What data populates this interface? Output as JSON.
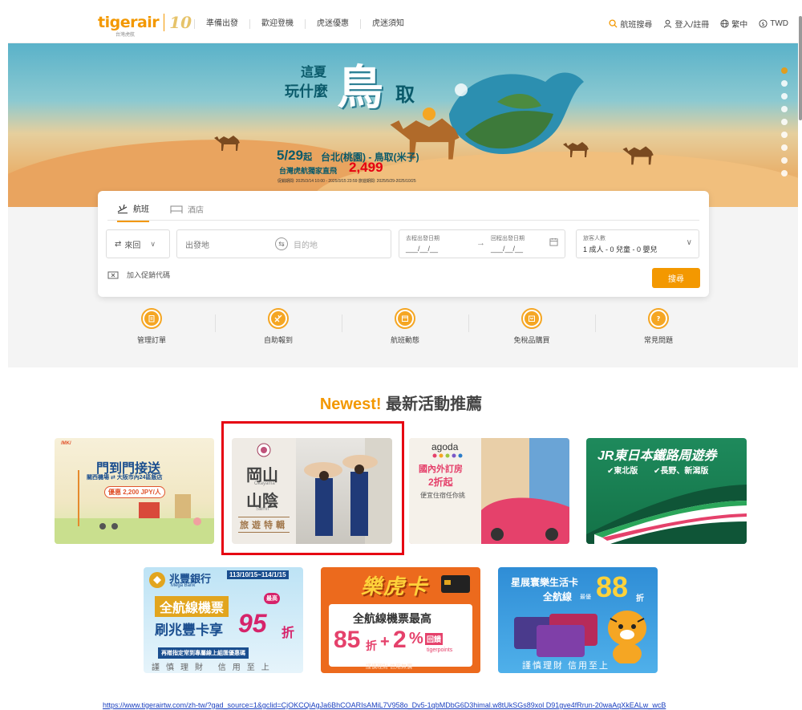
{
  "header": {
    "logo_text": "tigerair",
    "logo_sub": "台灣虎航",
    "logo_anniv": "10",
    "nav": [
      "準備出發",
      "歡迎登機",
      "虎迷優惠",
      "虎迷須知"
    ],
    "flight_search": "航班搜尋",
    "login": "登入/註冊",
    "language": "繁中",
    "currency": "TWD"
  },
  "hero": {
    "line1": "這夏",
    "line2": "玩什麼",
    "big": "鳥",
    "big2": "取",
    "date": "5/29",
    "date_small": "起",
    "route": "台北(桃園) - 鳥取(米子)",
    "price_label": "台灣虎航獨家直飛",
    "price": "2,499",
    "fine": "促銷期間: 2025/3/14 10:00 - 2025/3/15 23:59   旅遊期間: 2025/5/29-2025/10/25",
    "slide_count": 9,
    "active_slide": 0
  },
  "search": {
    "tab_flight": "航班",
    "tab_hotel": "酒店",
    "trip_type": "來回",
    "from_placeholder": "出發地",
    "to_placeholder": "目的地",
    "depart_label": "去程出發日期",
    "return_label": "回程出發日期",
    "depart_value": "___/__/__",
    "return_value": "___/__/__",
    "pax_label": "旅客人數",
    "pax_value": "1 成人 - 0 兒童 - 0 嬰兒",
    "promo_code": "加入促銷代碼",
    "search_button": "搜尋"
  },
  "quick_links": [
    "管理訂單",
    "自助報到",
    "航班動態",
    "免稅品購買",
    "常見問題"
  ],
  "promotions": {
    "title_highlight": "Newest!",
    "title_rest": "最新活動推薦",
    "b1": {
      "title": "門到門接送",
      "sub": "關西機場 ⇄ 大阪市內24區飯店",
      "price": "優惠 2,200 JPY/人"
    },
    "b2": {
      "line1": "岡山",
      "line1_en": "Okayama",
      "line2": "山陰",
      "line2_en": "San'in",
      "tag": "旅遊特輯"
    },
    "b3": {
      "brand": "agoda",
      "line1": "國內外訂房",
      "line2": "2折起",
      "line3": "便宜住宿任你挑"
    },
    "b4": {
      "title": "JR東日本鐵路周遊券",
      "sub1": "東北版",
      "sub2": "長野、新潟版"
    },
    "b5": {
      "bank": "兆豐銀行",
      "bank_en": "Mega Bank",
      "period": "113/10/15~114/1/15",
      "line1": "全航線機票",
      "badge": "最高",
      "line2": "刷兆豐卡享",
      "discount": "95",
      "unit": "折",
      "note": "再贈指定常到專屬線上組匯優惠碼",
      "footer": "謹慎理財 信用至上"
    },
    "b6": {
      "title": "樂虎卡",
      "line1": "全航線機票最高",
      "d1": "85",
      "d1_unit": "折",
      "plus": "+",
      "d2": "2",
      "d2_unit": "%",
      "d2_sub": "回饋",
      "d2_brand": "tigerpoints",
      "footer": "謹慎理財 信用無價"
    },
    "b7": {
      "line1": "星展寰樂生活卡",
      "line2": "全航線",
      "max": "最優",
      "discount": "88",
      "unit": "折",
      "footer": "謹慎理財 信用至上"
    }
  },
  "url": "https://www.tigerairtw.com/zh-tw/?gad_source=1&gclid=CjOKCQiAgJa6BhCOARIsAMiL7V958o_Dv5-1qbMDbG6D3himal.w8tUkSGs89xol D91gve4fRrun-20waAqXkEALw_wcB",
  "colors": {
    "brand": "#f39800",
    "highlight_border": "#e60012"
  }
}
